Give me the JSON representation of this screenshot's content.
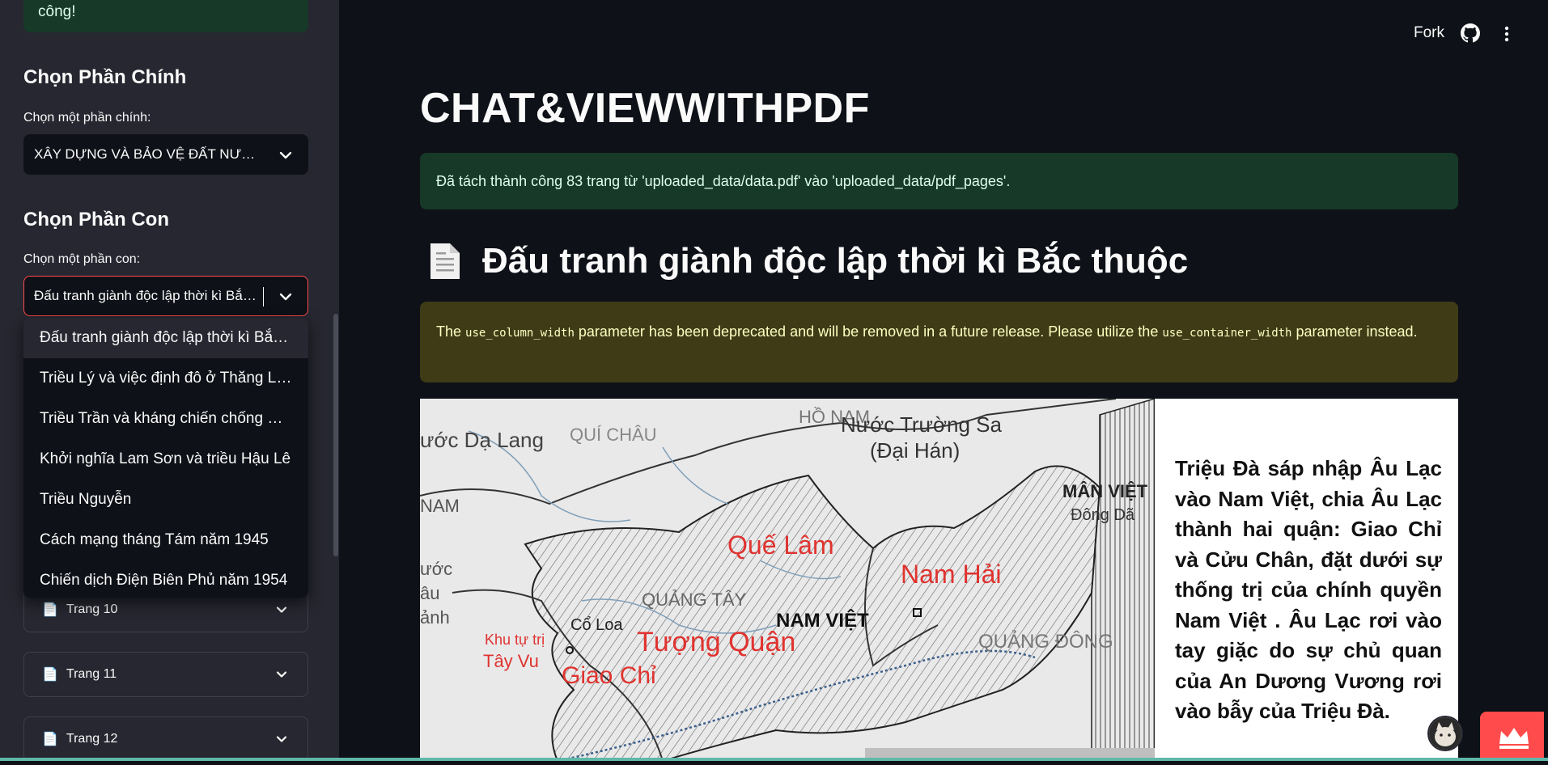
{
  "sidebar": {
    "top_success_text": "công!",
    "main_section_heading": "Chọn Phần Chính",
    "main_select_label": "Chọn một phần chính:",
    "main_select_value": "XÂY DỰNG VÀ BẢO VỆ ĐẤT NƯỚC",
    "sub_section_heading": "Chọn Phần Con",
    "sub_select_label": "Chọn một phần con:",
    "sub_select_value": "Đấu tranh giành độc lập thời kì Bắc thuộc",
    "dropdown_options": [
      "Đấu tranh giành độc lập thời kì Bắc thuộc",
      "Triều Lý và việc định đô ở Thăng Long",
      "Triều Trần và kháng chiến chống Mông Nguyên",
      "Khởi nghĩa Lam Sơn và triều Hậu Lê",
      "Triều Nguyễn",
      "Cách mạng tháng Tám năm 1945",
      "Chiến dịch Điện Biên Phủ năm 1954"
    ],
    "expanders": [
      "Trang 10",
      "Trang 11",
      "Trang 12"
    ]
  },
  "header": {
    "fork_label": "Fork",
    "github_icon": "github-icon",
    "menu_icon": "kebab-menu-icon"
  },
  "main": {
    "title": "CHAT&VIEWWITHPDF",
    "success_message": "Đã tách thành công 83 trang từ 'uploaded_data/data.pdf' vào 'uploaded_data/pdf_pages'.",
    "page_heading": "Đấu tranh giành độc lập thời kì Bắc thuộc",
    "warning": {
      "part1": "The ",
      "code1": "use_column_width",
      "part2": " parameter has been deprecated and will be removed in a future release. Please utilize the ",
      "code2": "use_container_width",
      "part3": " parameter instead."
    },
    "page_image": {
      "side_text": "Triệu Đà sáp nhập Âu Lạc vào Nam Việt, chia Âu Lạc thành hai quận: Giao Chỉ và Cửu Chân, đặt dưới sự thống trị của chính quyền Nam Việt . Âu Lạc rơi vào tay giặc do sự chủ quan của An Dương Vương rơi vào bẫy của Triệu Đà.",
      "map_labels": {
        "da_lang": "ước Dạ Lang",
        "qui_chau": "QUÍ CHÂU",
        "ho_nam": "HỒ NAM",
        "truong_sa": "Nước Trường Sa",
        "dai_han": "(Đại Hán)",
        "man_viet": "MÂN VIỆT",
        "dong_da": "Đông Dã",
        "nam": "NAM",
        "que_lam": "Quế Lâm",
        "nam_hai": "Nam Hải",
        "quang_tay": "QUẢNG TÂY",
        "nam_viet": "NAM VIỆT",
        "quang_dong": "QUẢNG ĐÔNG",
        "tuong_quan": "Tượng Quận",
        "giao_chi": "Giao Chỉ",
        "co_loa": "Cổ Loa",
        "khu_tu_tri": "Khu tự trị",
        "tay_vu": "Tây Vu",
        "uoc": "ước",
        "au": "âu",
        "anh": "ảnh"
      }
    }
  },
  "colors": {
    "app_bg": "#0e1117",
    "sidebar_bg": "#262730",
    "success_bg": "#173928",
    "warning_bg": "#3e3b16",
    "accent": "#ff4b4b"
  }
}
